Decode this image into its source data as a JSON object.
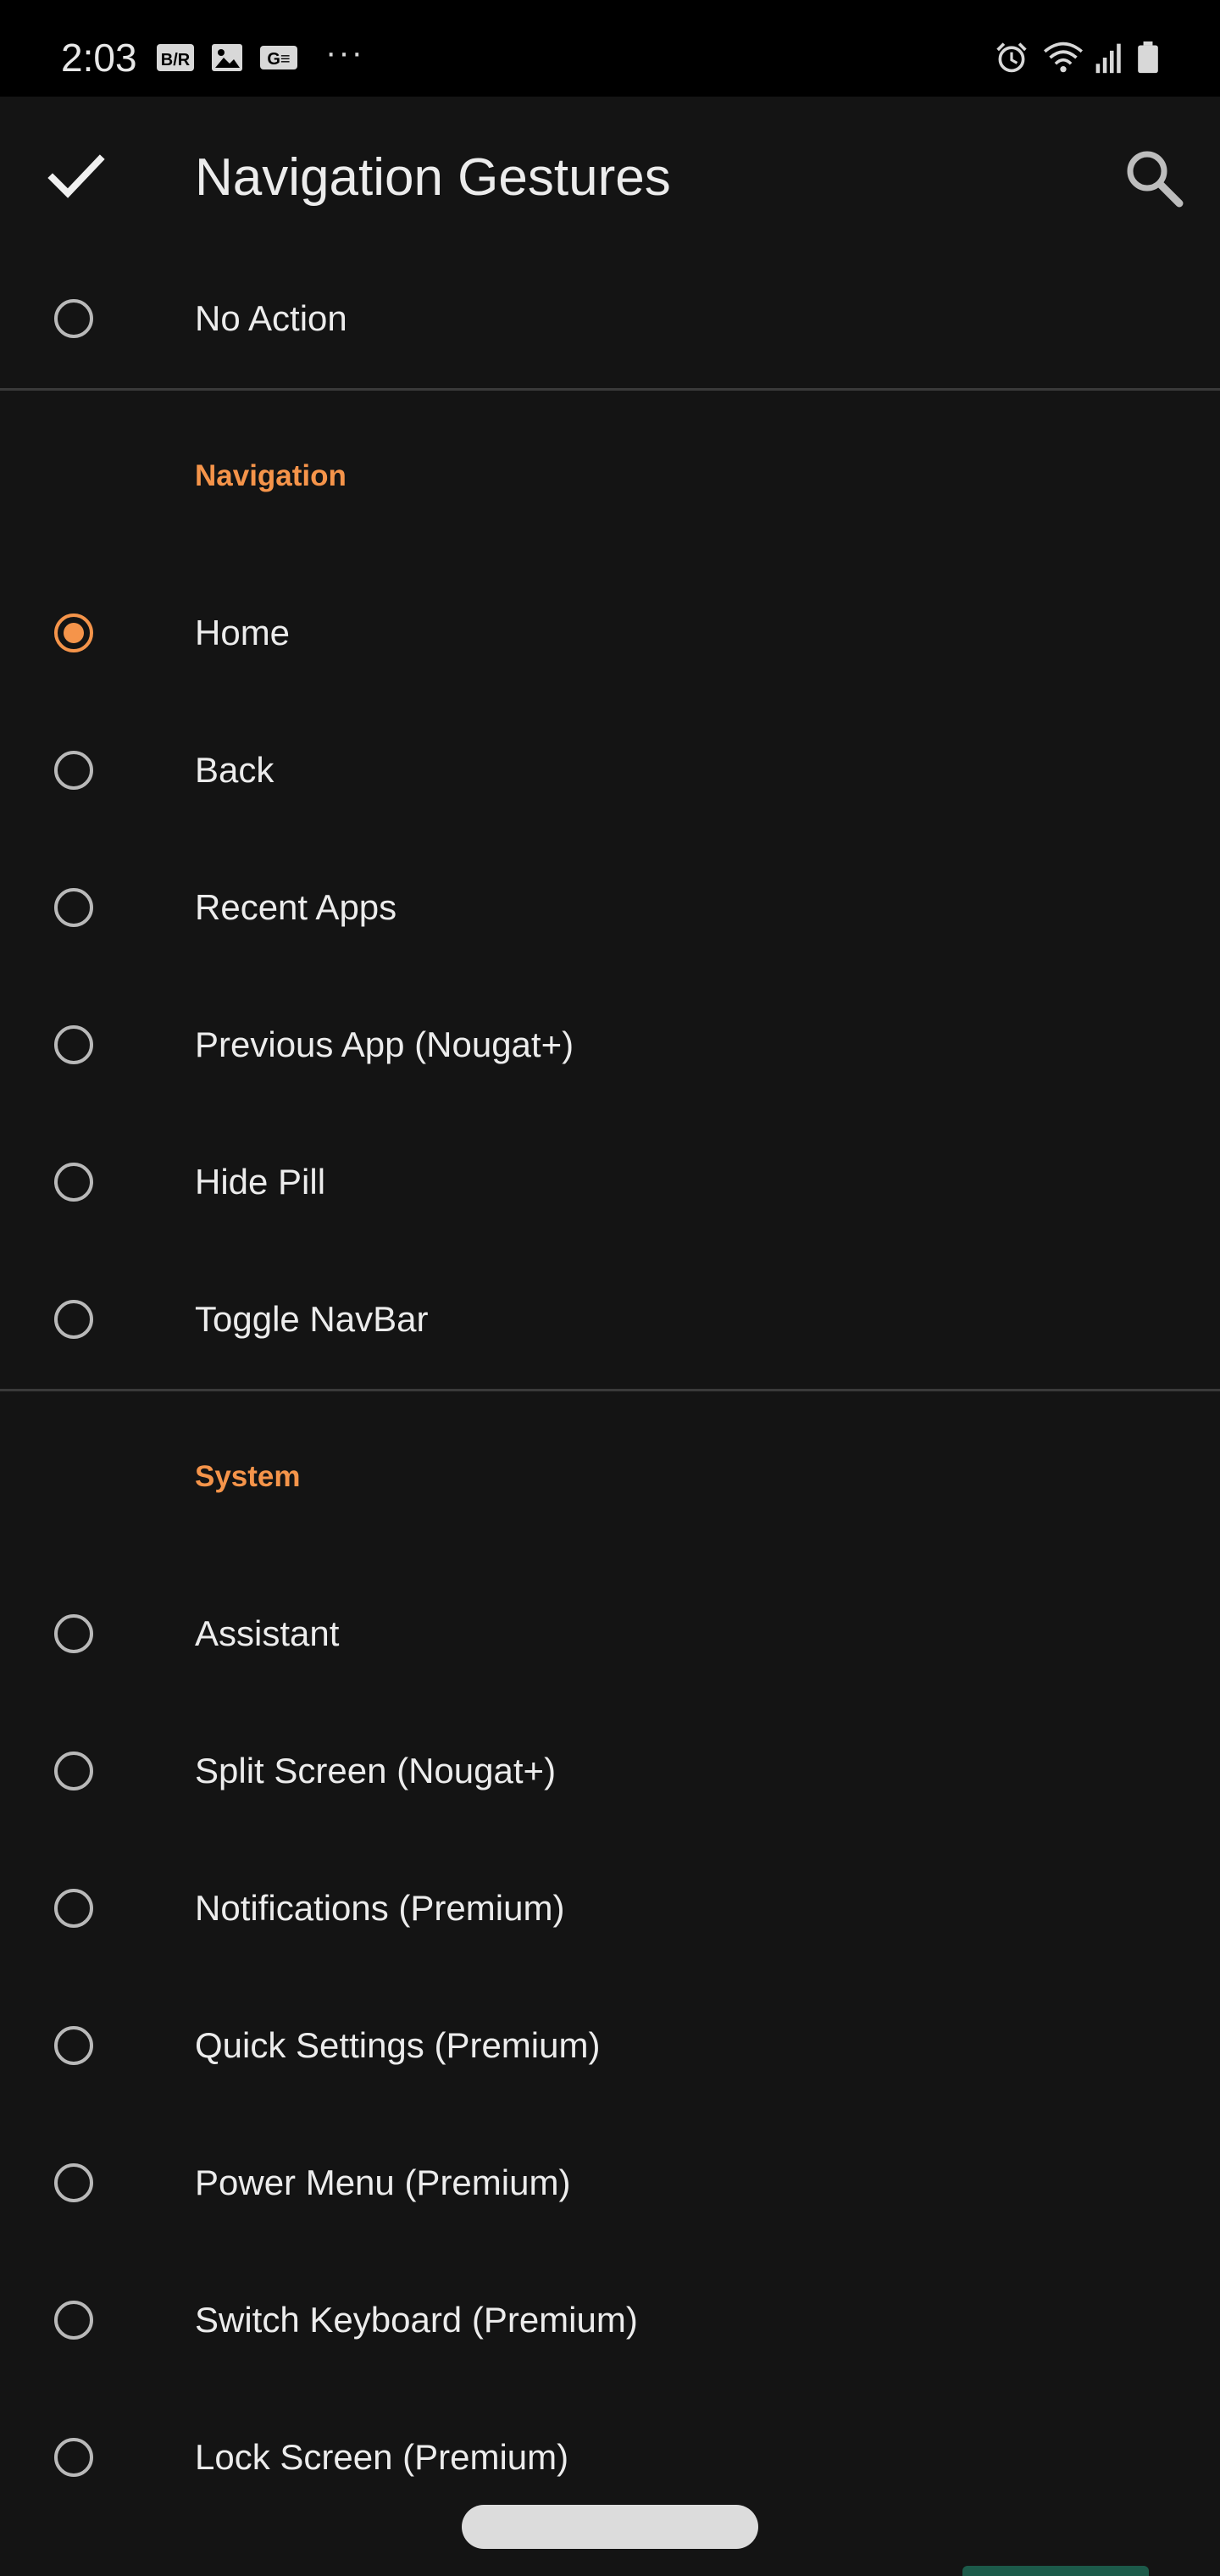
{
  "status_bar": {
    "time": "2:03",
    "notification_icons": [
      "br-icon",
      "image-icon",
      "ge-icon",
      "more-dots-icon"
    ],
    "system_icons": [
      "alarm-icon",
      "wifi-icon",
      "signal-icon",
      "battery-icon"
    ],
    "br_label": "B/R",
    "ge_label": "G≡",
    "more_label": "···"
  },
  "app_bar": {
    "title": "Navigation Gestures"
  },
  "options_top": [
    {
      "label": "No Action",
      "selected": false
    }
  ],
  "sections": [
    {
      "header": "Navigation",
      "items": [
        {
          "label": "Home",
          "selected": true
        },
        {
          "label": "Back",
          "selected": false
        },
        {
          "label": "Recent Apps",
          "selected": false
        },
        {
          "label": "Previous App (Nougat+)",
          "selected": false
        },
        {
          "label": "Hide Pill",
          "selected": false
        },
        {
          "label": "Toggle NavBar",
          "selected": false
        }
      ]
    },
    {
      "header": "System",
      "items": [
        {
          "label": "Assistant",
          "selected": false
        },
        {
          "label": "Split Screen (Nougat+)",
          "selected": false
        },
        {
          "label": "Notifications (Premium)",
          "selected": false
        },
        {
          "label": "Quick Settings (Premium)",
          "selected": false
        },
        {
          "label": "Power Menu (Premium)",
          "selected": false
        },
        {
          "label": "Switch Keyboard (Premium)",
          "selected": false
        },
        {
          "label": "Lock Screen (Premium)",
          "selected": false
        }
      ]
    }
  ],
  "colors": {
    "accent": "#f5944a",
    "background": "#141414",
    "status_bar": "#000000",
    "divider": "#3a3a3a",
    "text": "#ececec"
  }
}
